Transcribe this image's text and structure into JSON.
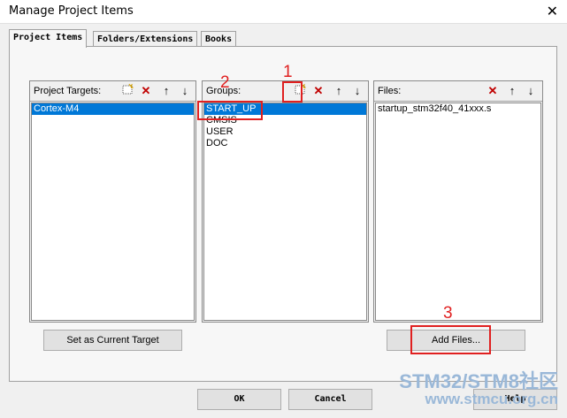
{
  "window": {
    "title": "Manage Project Items",
    "close_glyph": "✕"
  },
  "tabs": [
    {
      "label": "Project Items",
      "active": true
    },
    {
      "label": "Folders/Extensions",
      "active": false
    },
    {
      "label": "Books",
      "active": false
    }
  ],
  "targets": {
    "label": "Project Targets:",
    "items": [
      "Cortex-M4"
    ],
    "selected": 0,
    "toolbar": [
      "new-icon",
      "delete-icon",
      "move-up-icon",
      "move-down-icon"
    ]
  },
  "groups": {
    "label": "Groups:",
    "items": [
      "START_UP",
      "CMSIS",
      "USER",
      "DOC"
    ],
    "selected": 0,
    "toolbar": [
      "new-icon",
      "delete-icon",
      "move-up-icon",
      "move-down-icon"
    ]
  },
  "files": {
    "label": "Files:",
    "items": [
      "startup_stm32f40_41xxx.s"
    ],
    "toolbar": [
      "delete-icon",
      "move-up-icon",
      "move-down-icon"
    ]
  },
  "buttons": {
    "set_current": "Set as Current Target",
    "add_files": "Add Files...",
    "ok": "OK",
    "cancel": "Cancel",
    "help": "Help"
  },
  "annotations": {
    "one": "1",
    "two": "2",
    "three": "3",
    "color": "#e02020"
  },
  "watermark": {
    "line1": "STM32/STM8社区",
    "line2": "www.stmcu.org.cn"
  }
}
